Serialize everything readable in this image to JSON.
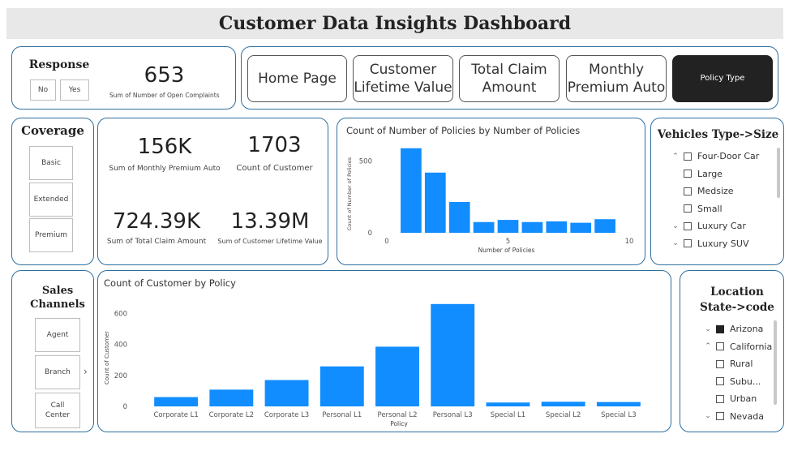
{
  "header": {
    "title": "Customer Data Insights Dashboard"
  },
  "response": {
    "title": "Response",
    "options": [
      "No",
      "Yes"
    ],
    "kpi_value": "653",
    "kpi_label": "Sum of Number of Open Complaints"
  },
  "nav": {
    "buttons": [
      "Home Page",
      "Customer Lifetime Value",
      "Total Claim Amount",
      "Monthly Premium Auto",
      "Policy Type"
    ],
    "active": "Policy Type"
  },
  "coverage": {
    "title": "Coverage",
    "options": [
      "Basic",
      "Extended",
      "Premium"
    ]
  },
  "kpis": [
    {
      "value": "156K",
      "label": "Sum of Monthly Premium Auto"
    },
    {
      "value": "1703",
      "label": "Count of Customer"
    },
    {
      "value": "724.39K",
      "label": "Sum of Total Claim Amount"
    },
    {
      "value": "13.39M",
      "label": "Sum of Customer Lifetime Value"
    }
  ],
  "vehicles": {
    "title": "Vehicles Type->Size",
    "items": [
      {
        "label": "Four-Door Car",
        "level": 0,
        "chevron": "up",
        "checked": false
      },
      {
        "label": "Large",
        "level": 1,
        "checked": false
      },
      {
        "label": "Medsize",
        "level": 1,
        "checked": false
      },
      {
        "label": "Small",
        "level": 1,
        "checked": false
      },
      {
        "label": "Luxury Car",
        "level": 0,
        "chevron": "down",
        "checked": false
      },
      {
        "label": "Luxury SUV",
        "level": 0,
        "chevron": "down",
        "checked": false
      }
    ]
  },
  "sales": {
    "title": "Sales Channels",
    "title_line1": "Sales",
    "title_line2": "Channels",
    "options": [
      "Agent",
      "Branch",
      "Call Center"
    ],
    "call_center_line1": "Call",
    "call_center_line2": "Center",
    "expand_icon": "chevron-right-icon"
  },
  "location": {
    "title_line1": "Location",
    "title_line2": "State->code",
    "items": [
      {
        "label": "Arizona",
        "level": 0,
        "chevron": "down",
        "checked": true
      },
      {
        "label": "California",
        "level": 0,
        "chevron": "up",
        "checked": false
      },
      {
        "label": "Rural",
        "level": 1,
        "checked": false
      },
      {
        "label": "Subu...",
        "level": 1,
        "checked": false
      },
      {
        "label": "Urban",
        "level": 1,
        "checked": false
      },
      {
        "label": "Nevada",
        "level": 0,
        "chevron": "down",
        "checked": false
      }
    ]
  },
  "colors": {
    "bar": "#118DFF",
    "border": "#2f6f9f",
    "title_bg": "#e8e8e8",
    "active_button": "#222222"
  },
  "chart_data": [
    {
      "type": "bar",
      "title": "Count of Number of Policies by Number of Policies",
      "xlabel": "Number of Policies",
      "ylabel": "Count of Number of Policies",
      "x": [
        1,
        2,
        3,
        4,
        5,
        6,
        7,
        8,
        9
      ],
      "values": [
        590,
        420,
        215,
        75,
        90,
        75,
        80,
        70,
        95
      ],
      "xlim": [
        0,
        10
      ],
      "xticks": [
        0,
        5,
        10
      ],
      "yticks": [
        0,
        500
      ],
      "ylim": [
        0,
        600
      ],
      "grid": false
    },
    {
      "type": "bar",
      "title": "Count of Customer by Policy",
      "xlabel": "Policy",
      "ylabel": "Count of Customer",
      "categories": [
        "Corporate L1",
        "Corporate L2",
        "Corporate L3",
        "Personal L1",
        "Personal L2",
        "Personal L3",
        "Special L1",
        "Special L2",
        "Special L3"
      ],
      "values": [
        60,
        108,
        170,
        258,
        385,
        660,
        25,
        30,
        28
      ],
      "yticks": [
        0,
        200,
        400,
        600
      ],
      "ylim": [
        0,
        680
      ],
      "grid": false
    }
  ]
}
